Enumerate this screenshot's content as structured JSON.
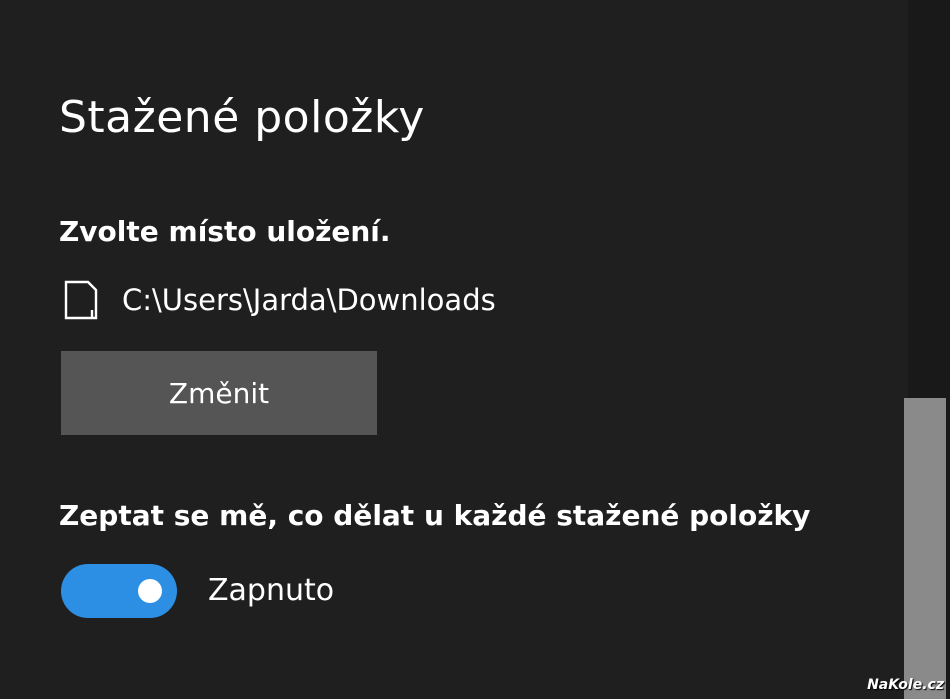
{
  "downloads": {
    "title": "Stažené položky",
    "location_label": "Zvolte místo uložení.",
    "location_icon": "document-icon",
    "path": "C:\\Users\\Jarda\\Downloads",
    "change_button_label": "Změnit",
    "ask_label": "Zeptat se mě, co dělat u každé stažené položky",
    "ask_toggle_state": "Zapnuto",
    "ask_toggle_on": true
  },
  "colors": {
    "background": "#1f1f1f",
    "button": "#555555",
    "accent": "#2d8fe4",
    "scrollbar_thumb": "#8a8a8a"
  },
  "watermark": "NaKole.cz"
}
